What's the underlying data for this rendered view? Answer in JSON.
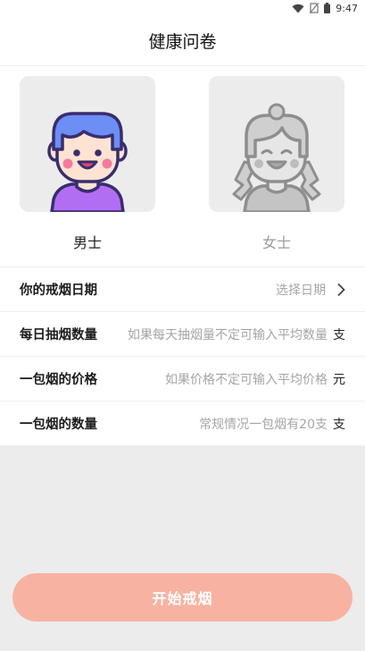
{
  "status_bar": {
    "time": "9:47",
    "icons": [
      "wifi-icon",
      "no-sim-icon",
      "battery-icon"
    ]
  },
  "header": {
    "title": "健康问卷"
  },
  "gender": {
    "male_label": "男士",
    "female_label": "女士",
    "selected": "male"
  },
  "form": {
    "quit_date": {
      "label": "你的戒烟日期",
      "placeholder": "选择日期"
    },
    "daily_count": {
      "label": "每日抽烟数量",
      "placeholder": "如果每天抽烟量不定可输入平均数量",
      "unit": "支"
    },
    "pack_price": {
      "label": "一包烟的价格",
      "placeholder": "如果价格不定可输入平均价格",
      "unit": "元"
    },
    "pack_count": {
      "label": "一包烟的数量",
      "placeholder": "常规情况一包烟有20支",
      "unit": "支"
    }
  },
  "start_button": {
    "label": "开始戒烟"
  },
  "colors": {
    "accent": "#f8b2a1",
    "male_hair": "#6c8ef5",
    "male_shirt": "#b26ef2",
    "avatar_bg": "#ececec"
  }
}
